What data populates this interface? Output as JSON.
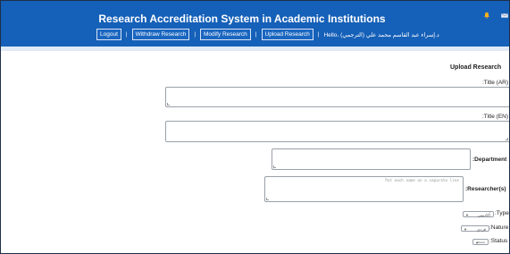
{
  "header": {
    "title": "Research Accreditation System in Academic Institutions",
    "greeting": "Hello، د.إسراء عبد القاسم محمد علي (الترجمي)",
    "nav": {
      "logout": "Logout",
      "withdraw": "Withdraw Research",
      "modify": "Modify Research",
      "upload": "Upload Research",
      "separator": "|"
    },
    "icons": {
      "bell": "bell-icon",
      "mail": "mail-icon"
    },
    "colors": {
      "header_bg": "#1560b8",
      "strip": "#dfeaf6"
    }
  },
  "form": {
    "heading": "Upload Research",
    "title_ar_label": ":Title (AR)",
    "title_en_label": ":Title (EN)",
    "department_label": ":Department",
    "researchers_label": ":Researcher(s)",
    "researchers_placeholder": "Put each name on a separate line",
    "type_label": ":Type",
    "type_value": "أكاديمي",
    "nature_label": ":Nature",
    "nature_value": "فردي",
    "status_label": ":Status",
    "status_value": "Status"
  }
}
